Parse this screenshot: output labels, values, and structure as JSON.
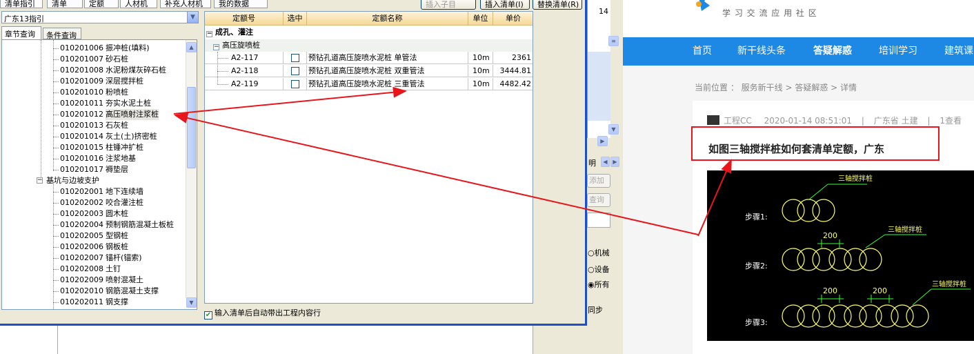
{
  "app": {
    "top_tabs": [
      "清单指引",
      "清单",
      "定额",
      "人材机",
      "补充人材机",
      "我的数据"
    ],
    "top_buttons": [
      "插入子目",
      "插入清单(I)",
      "替换清单(R)"
    ],
    "combo_value": "广东13指引",
    "left_tabs": [
      "章节查询",
      "条件查询"
    ],
    "tree": [
      {
        "code": "010201006",
        "name": "振冲桩(填料)"
      },
      {
        "code": "010201007",
        "name": "砂石桩"
      },
      {
        "code": "010201008",
        "name": "水泥粉煤灰碎石桩"
      },
      {
        "code": "010201009",
        "name": "深层搅拌桩"
      },
      {
        "code": "010201010",
        "name": "粉喷桩"
      },
      {
        "code": "010201011",
        "name": "夯实水泥土桩"
      },
      {
        "code": "010201012",
        "name": "高压喷射注浆桩"
      },
      {
        "code": "010201013",
        "name": "石灰桩"
      },
      {
        "code": "010201014",
        "name": "灰土(土)挤密桩"
      },
      {
        "code": "010201015",
        "name": "柱锤冲扩桩"
      },
      {
        "code": "010201016",
        "name": "注浆地基"
      },
      {
        "code": "010201017",
        "name": "褥垫层"
      }
    ],
    "tree_group": "基坑与边坡支护",
    "tree2": [
      {
        "code": "010202001",
        "name": "地下连续墙"
      },
      {
        "code": "010202002",
        "name": "咬合灌注桩"
      },
      {
        "code": "010202003",
        "name": "圆木桩"
      },
      {
        "code": "010202004",
        "name": "预制钢筋混凝土板桩"
      },
      {
        "code": "010202005",
        "name": "型钢桩"
      },
      {
        "code": "010202006",
        "name": "钢板桩"
      },
      {
        "code": "010202007",
        "name": "锚杆(锚索)"
      },
      {
        "code": "010202008",
        "name": "土钉"
      },
      {
        "code": "010202009",
        "name": "喷射混凝土"
      },
      {
        "code": "010202010",
        "name": "钢筋混凝土支撑"
      },
      {
        "code": "010202011",
        "name": "钢支撑"
      }
    ],
    "grid_headers": [
      "定额号",
      "选中",
      "定额名称",
      "单位",
      "单价"
    ],
    "grid_group1": "成孔、灌注",
    "grid_group2": "高压旋喷桩",
    "rows": [
      {
        "code": "A2-117",
        "name": "预钻孔道高压旋喷水泥桩 单管法",
        "unit": "10m",
        "price": "2361"
      },
      {
        "code": "A2-118",
        "name": "预钻孔道高压旋喷水泥桩 双重管法",
        "unit": "10m",
        "price": "3444.81"
      },
      {
        "code": "A2-119",
        "name": "预钻孔道高压旋喷水泥桩 三重管法",
        "unit": "10m",
        "price": "4482.42"
      }
    ],
    "footer_check": "输入清单后自动带出工程内容行",
    "side_number": "14",
    "side_labels": [
      "明",
      "添加",
      "查询",
      "机械",
      "设备",
      "所有",
      "同步"
    ]
  },
  "web": {
    "logo_sub": "学 习 交 流 应 用 社 区",
    "nav": [
      "首页",
      "新干线头条",
      "答疑解惑",
      "培训学习",
      "建筑课"
    ],
    "crumb": "当前位置 ： 服务新干线 > 答疑解惑 > 详情",
    "author": "工程CC",
    "date": "2020-01-14 08:51:01",
    "region": "广东省",
    "topic": "土建",
    "views": "1查看",
    "question": "如图三轴搅拌桩如何套清单定额，广东",
    "cad_label": "三轴搅拌桩",
    "steps": [
      "步骤1:",
      "步骤2:",
      "步骤3:"
    ],
    "dim": "200"
  },
  "colors": {
    "nav": "#1e88e5",
    "arrow": "#e8161a",
    "cad_yellow": "#ffff66",
    "cad_green": "#33ff33"
  }
}
